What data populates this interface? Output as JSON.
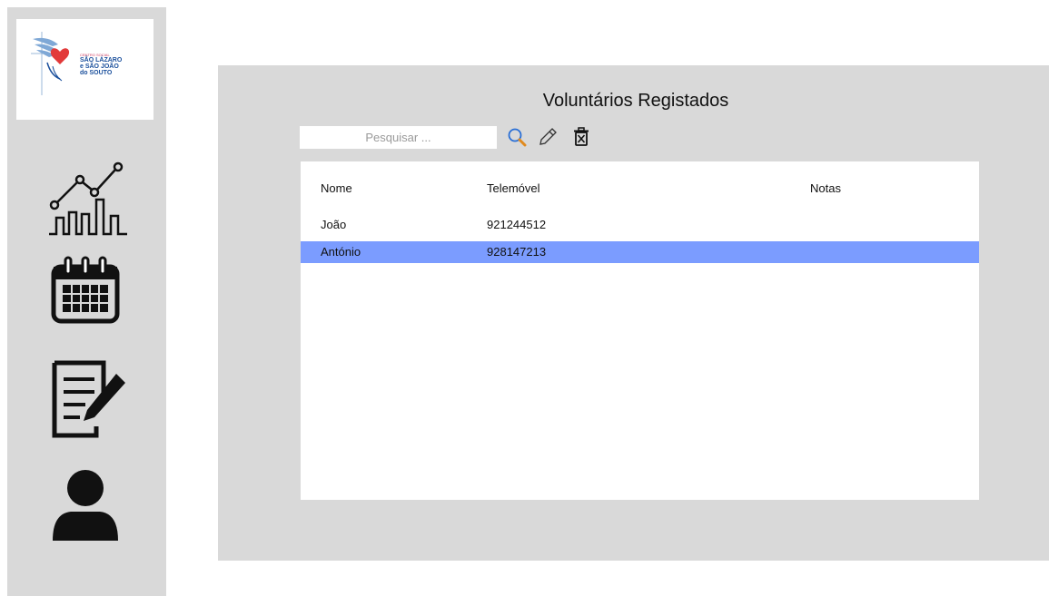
{
  "logo": {
    "line1": "CENTRO SOCIAL",
    "line2": "SÃO LÁZARO",
    "line3": "e SÃO JOÃO",
    "line4": "do SOUTO"
  },
  "sidebar": {
    "items": [
      {
        "name": "statistics",
        "icon": "chart-growth-icon"
      },
      {
        "name": "calendar",
        "icon": "calendar-icon"
      },
      {
        "name": "notes",
        "icon": "document-edit-icon"
      },
      {
        "name": "profile",
        "icon": "user-icon"
      }
    ]
  },
  "main": {
    "title": "Voluntários Registados",
    "search": {
      "placeholder": "Pesquisar ...",
      "value": ""
    },
    "toolbar": {
      "search_icon": "search-icon",
      "edit_icon": "pencil-icon",
      "delete_icon": "trash-icon"
    },
    "table": {
      "columns": [
        "Nome",
        "Telemóvel",
        "Notas"
      ],
      "rows": [
        {
          "nome": "João",
          "telemovel": "921244512",
          "notas": "",
          "selected": false
        },
        {
          "nome": "António",
          "telemovel": "928147213",
          "notas": "",
          "selected": true
        }
      ]
    }
  },
  "colors": {
    "panel_bg": "#d9d9d9",
    "selected_row": "#7b9cff",
    "search_icon_accent": "#e08a1e"
  }
}
